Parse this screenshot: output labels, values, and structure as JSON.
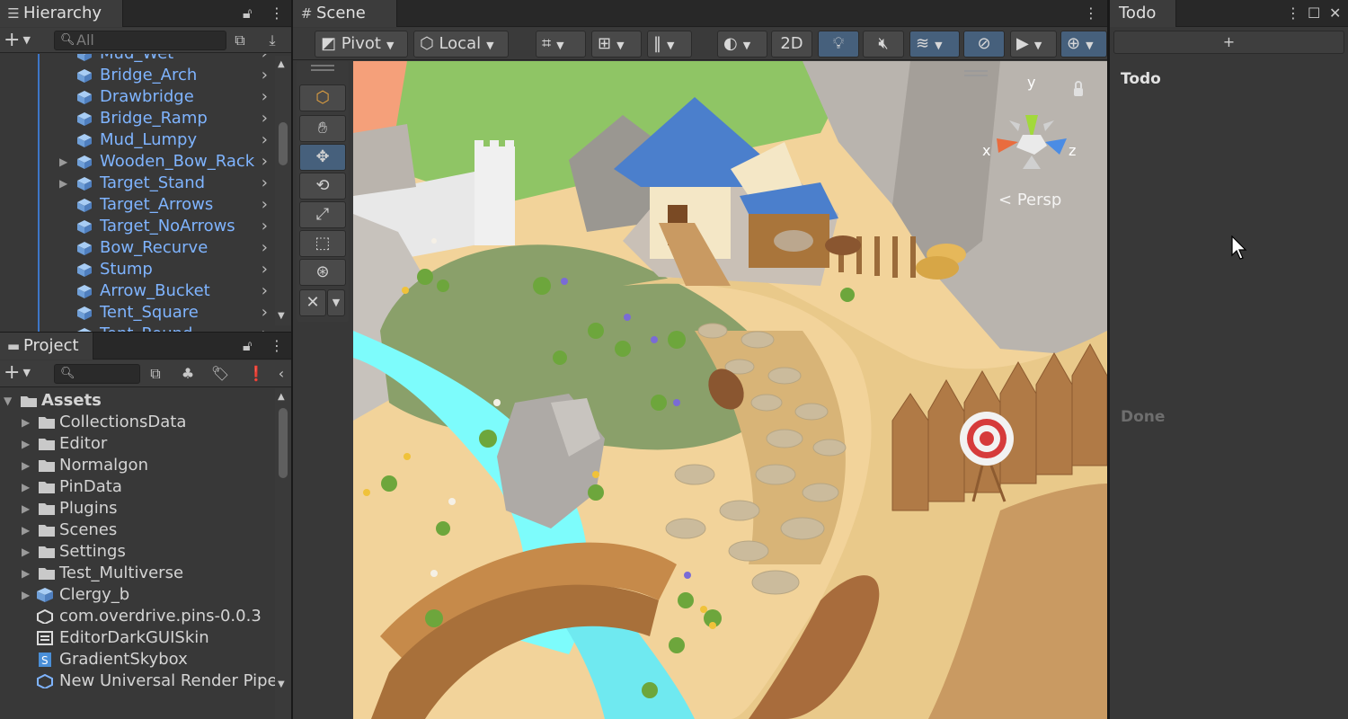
{
  "hierarchy": {
    "title": "Hierarchy",
    "search_placeholder": "All",
    "items": [
      {
        "label": "Mud_Wet",
        "expandable": false
      },
      {
        "label": "Bridge_Arch",
        "expandable": false
      },
      {
        "label": "Drawbridge",
        "expandable": false
      },
      {
        "label": "Bridge_Ramp",
        "expandable": false
      },
      {
        "label": "Mud_Lumpy",
        "expandable": false
      },
      {
        "label": "Wooden_Bow_Rack",
        "expandable": true
      },
      {
        "label": "Target_Stand",
        "expandable": true
      },
      {
        "label": "Target_Arrows",
        "expandable": false
      },
      {
        "label": "Target_NoArrows",
        "expandable": false
      },
      {
        "label": "Bow_Recurve",
        "expandable": false
      },
      {
        "label": "Stump",
        "expandable": false
      },
      {
        "label": "Arrow_Bucket",
        "expandable": false
      },
      {
        "label": "Tent_Square",
        "expandable": false
      },
      {
        "label": "Tent_Round",
        "expandable": false
      }
    ]
  },
  "project": {
    "title": "Project",
    "root": "Assets",
    "items": [
      {
        "label": "CollectionsData",
        "kind": "folder"
      },
      {
        "label": "Editor",
        "kind": "folder"
      },
      {
        "label": "Normalgon",
        "kind": "folder"
      },
      {
        "label": "PinData",
        "kind": "folder"
      },
      {
        "label": "Plugins",
        "kind": "folder"
      },
      {
        "label": "Scenes",
        "kind": "folder"
      },
      {
        "label": "Settings",
        "kind": "folder"
      },
      {
        "label": "Test_Multiverse",
        "kind": "folder"
      },
      {
        "label": "Clergy_b",
        "kind": "prefab"
      },
      {
        "label": "com.overdrive.pins-0.0.3",
        "kind": "package"
      },
      {
        "label": "EditorDarkGUISkin",
        "kind": "guiskin"
      },
      {
        "label": "GradientSkybox",
        "kind": "shader"
      },
      {
        "label": "New Universal Render Pipe",
        "kind": "asset"
      }
    ]
  },
  "scene": {
    "title": "Scene",
    "pivot_label": "Pivot",
    "space_label": "Local",
    "mode_2d_label": "2D",
    "projection_label": "Persp",
    "axis_labels": {
      "x": "x",
      "y": "y",
      "z": "z"
    }
  },
  "todo": {
    "title": "Todo",
    "add_label": "+",
    "section_todo": "Todo",
    "section_done": "Done"
  },
  "colors": {
    "accent_blue": "#46607c",
    "hierarchy_text": "#7fb4ff",
    "panel_bg": "#383838"
  }
}
